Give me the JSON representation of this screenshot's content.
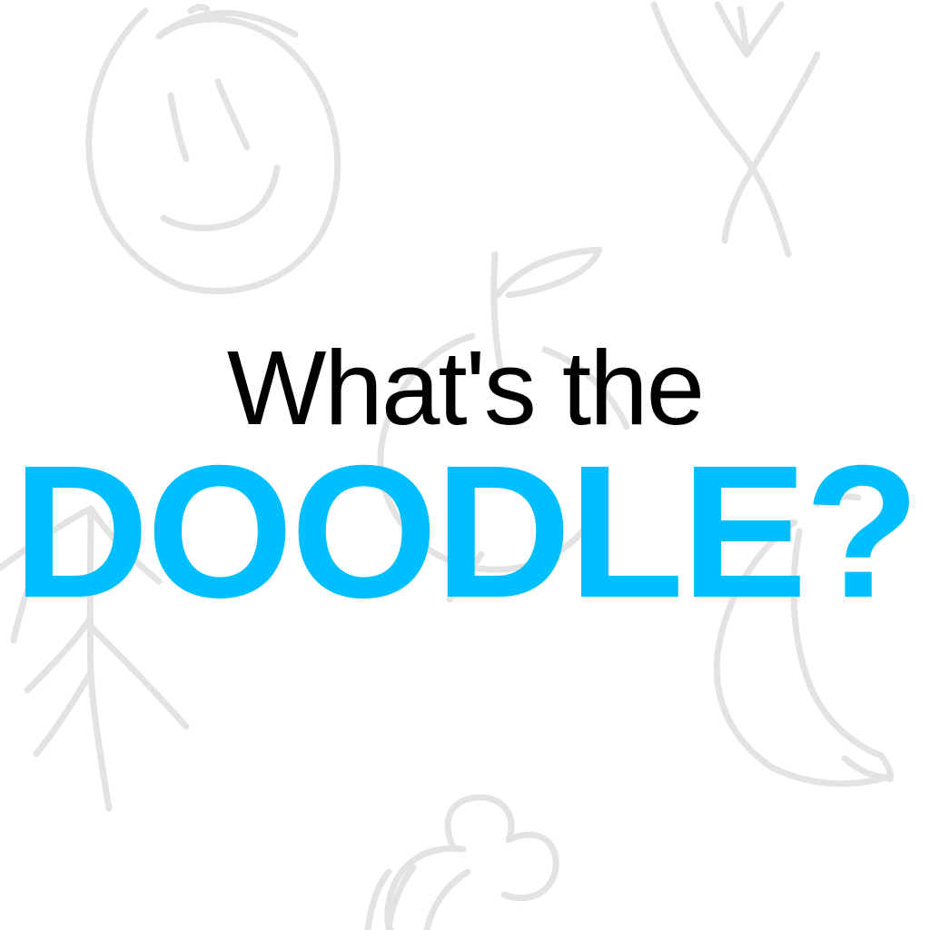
{
  "title": {
    "line1": "What's the",
    "line2": "DOODLE?"
  },
  "colors": {
    "background": "#ffffff",
    "line1_text": "#000000",
    "line2_text": "#00bfff",
    "doodle_stroke": "#e3e3e3"
  },
  "doodles": [
    "smiley-face-icon",
    "scissors-icon",
    "apple-icon",
    "stick-figure-icon",
    "banana-icon",
    "flower-icon"
  ]
}
